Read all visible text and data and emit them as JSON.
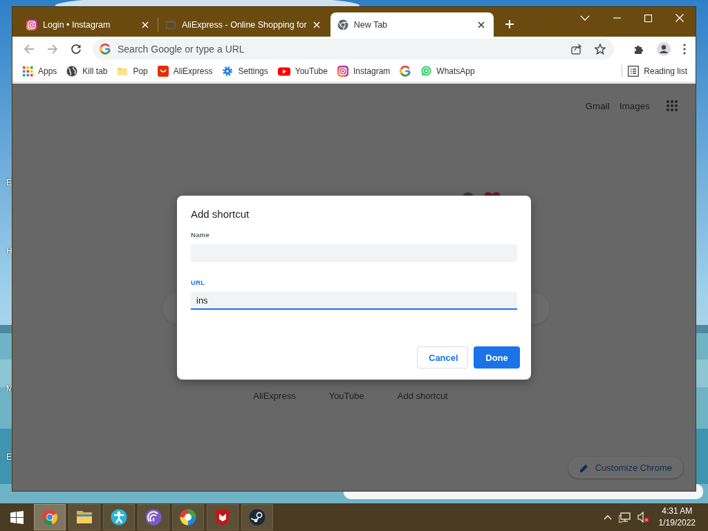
{
  "desktop": {
    "edge_labels": [
      "E",
      "H",
      "M",
      "E"
    ]
  },
  "browser": {
    "tabs": [
      {
        "title": "Login • Instagram",
        "kind": "camera",
        "selected": false
      },
      {
        "title": "AliExpress - Online Shopping for",
        "kind": "page",
        "selected": false
      },
      {
        "title": "New Tab",
        "kind": "chrome",
        "selected": true
      }
    ],
    "address_bar": {
      "placeholder": "Search Google or type a URL"
    },
    "bookmarks": [
      {
        "label": "Apps",
        "kind": "apps"
      },
      {
        "label": "Kill tab",
        "kind": "globe"
      },
      {
        "label": "Pop",
        "kind": "folder"
      },
      {
        "label": "AliExpress",
        "kind": "bag"
      },
      {
        "label": "Settings",
        "kind": "gear"
      },
      {
        "label": "YouTube",
        "kind": "play"
      },
      {
        "label": "Instagram",
        "kind": "camera"
      },
      {
        "kind": "g"
      },
      {
        "label": "WhatsApp",
        "kind": "chat"
      }
    ],
    "reading_list": "Reading list"
  },
  "page": {
    "links": [
      "Gmail",
      "Images"
    ],
    "shortcuts": [
      "AliExpress",
      "YouTube",
      "Add shortcut"
    ],
    "customize": "Customize Chrome"
  },
  "dialog": {
    "title": "Add shortcut",
    "fields": [
      {
        "label": "Name",
        "focused": false
      },
      {
        "label": "URL",
        "value": "ins",
        "focused": true
      }
    ],
    "buttons": [
      {
        "label": "Cancel",
        "kind": "secondary"
      },
      {
        "label": "Done",
        "kind": "primary"
      }
    ]
  },
  "taskbar": {
    "apps": [
      {
        "kind": "chrome",
        "selected": true
      },
      {
        "kind": "folder",
        "selected": false
      },
      {
        "kind": "person",
        "selected": false
      },
      {
        "kind": "torrent",
        "selected": false
      },
      {
        "kind": "swirl",
        "selected": false
      },
      {
        "kind": "shield",
        "selected": false
      },
      {
        "kind": "steam",
        "selected": false
      }
    ],
    "clock": {
      "time": "4:31 AM",
      "date": "1/19/2022"
    }
  }
}
